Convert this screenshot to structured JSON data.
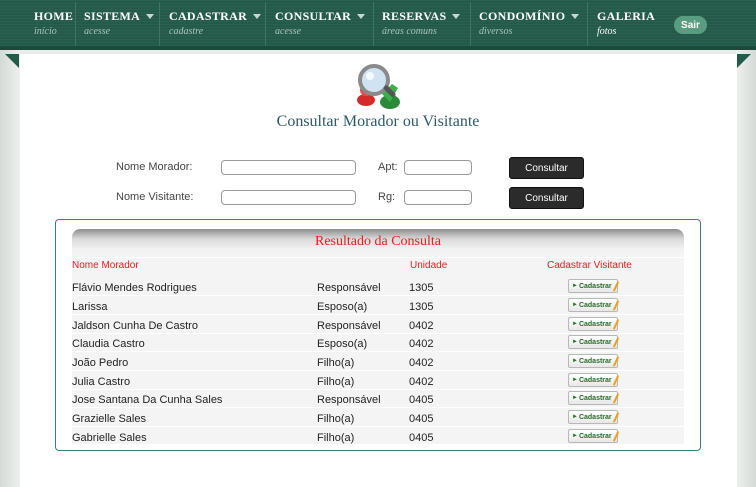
{
  "nav": {
    "items": [
      {
        "label": "HOME",
        "sub": "início",
        "caret": false
      },
      {
        "label": "SISTEMA",
        "sub": "acesse",
        "caret": true
      },
      {
        "label": "CADASTRAR",
        "sub": "cadastre",
        "caret": true
      },
      {
        "label": "CONSULTAR",
        "sub": "acesse",
        "caret": true
      },
      {
        "label": "RESERVAS",
        "sub": "áreas comuns",
        "caret": true
      },
      {
        "label": "CONDOMÍNIO",
        "sub": "diversos",
        "caret": true
      },
      {
        "label": "GALERIA",
        "sub": "fotos",
        "caret": false
      }
    ],
    "logout_label": "Sair"
  },
  "page": {
    "title": "Consultar Morador ou Visitante"
  },
  "form": {
    "morador_label": "Nome Morador:",
    "morador_value": "",
    "apt_label": "Apt:",
    "apt_value": "",
    "visitante_label": "Nome Visitante:",
    "visitante_value": "",
    "rg_label": "Rg:",
    "rg_value": "",
    "consultar_label": "Consultar"
  },
  "results": {
    "title": "Resultado da Consulta",
    "columns": [
      "Nome Morador",
      "Unidade",
      "Cadastrar Visitante"
    ],
    "button_label": "Cadastrar",
    "rows": [
      {
        "nome": "Flávio Mendes Rodrigues",
        "tipo": "Responsável",
        "unidade": "1305"
      },
      {
        "nome": "Larissa",
        "tipo": "Esposo(a)",
        "unidade": "1305"
      },
      {
        "nome": "Jaldson Cunha De Castro",
        "tipo": "Responsável",
        "unidade": "0402"
      },
      {
        "nome": "Claudia Castro",
        "tipo": "Esposo(a)",
        "unidade": "0402"
      },
      {
        "nome": "João Pedro",
        "tipo": "Filho(a)",
        "unidade": "0402"
      },
      {
        "nome": "Julia Castro",
        "tipo": "Filho(a)",
        "unidade": "0402"
      },
      {
        "nome": "Jose Santana Da Cunha Sales",
        "tipo": "Responsável",
        "unidade": "0405"
      },
      {
        "nome": "Grazielle Sales",
        "tipo": "Filho(a)",
        "unidade": "0405"
      },
      {
        "nome": "Gabrielle Sales",
        "tipo": "Filho(a)",
        "unidade": "0405"
      }
    ]
  },
  "colors": {
    "nav_bg": "#245a4a",
    "accent_red": "#e02020",
    "title_teal": "#2c5966",
    "button_dark": "#2b2b2b"
  },
  "icons": {
    "search": "search-users-icon"
  }
}
